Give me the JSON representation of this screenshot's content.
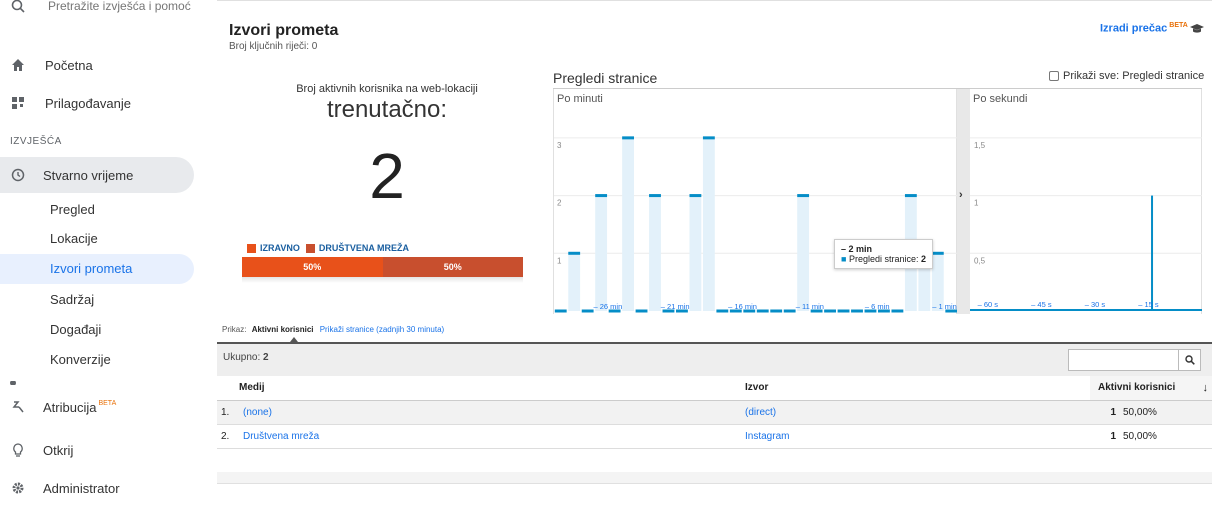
{
  "sidebar": {
    "search_placeholder": "Pretražite izvješća i pomoć",
    "home": "Početna",
    "customize": "Prilagođavanje",
    "reports_header": "IZVJEŠĆA",
    "realtime": "Stvarno vrijeme",
    "sub": [
      "Pregled",
      "Lokacije",
      "Izvori prometa",
      "Sadržaj",
      "Događaji",
      "Konverzije"
    ],
    "attribution": "Atribucija",
    "attribution_badge": "BETA",
    "discover": "Otkrij",
    "admin": "Administrator"
  },
  "header": {
    "title": "Izvori prometa",
    "keywords": "Broj ključnih riječi: 0",
    "shortcut": "Izradi prečac",
    "shortcut_badge": "BETA"
  },
  "active_users": {
    "label": "Broj aktivnih korisnika na web-lokaciji",
    "now": "trenutačno:",
    "count": "2",
    "legend": [
      "IZRAVNO",
      "DRUŠTVENA MREŽA"
    ],
    "bar": [
      "50%",
      "50%"
    ],
    "colors": [
      "#e8511a",
      "#c84f2e"
    ]
  },
  "pageviews": {
    "title": "Pregledi stranice",
    "show_all": "Prikaži sve: Pregledi stranice",
    "per_minute": "Po minuti",
    "per_second": "Po sekundi",
    "tooltip_title": "– 2 min",
    "tooltip_label": "Pregledi stranice:",
    "tooltip_value": "2",
    "min_yticks": [
      "3",
      "2",
      "1"
    ],
    "min_xticks": [
      "– 26 min",
      "– 21 min",
      "– 16 min",
      "– 11 min",
      "– 6 min",
      "– 1 min"
    ],
    "sec_yticks": [
      "1,5",
      "1",
      "0,5"
    ],
    "sec_xticks": [
      "– 60 s",
      "– 45 s",
      "– 30 s",
      "– 15 s"
    ]
  },
  "chart_data": [
    {
      "type": "bar",
      "title": "Po minuti",
      "series": [
        {
          "name": "Pregledi stranice",
          "values": [
            0,
            1,
            0,
            2,
            0,
            3,
            0,
            2,
            0,
            0,
            2,
            3,
            0,
            0,
            0,
            0,
            0,
            0,
            2,
            0,
            0,
            0,
            0,
            0,
            0,
            0,
            2,
            1,
            1,
            0
          ]
        }
      ],
      "ylim": [
        0,
        3.5
      ],
      "color": "#058dc7"
    },
    {
      "type": "bar",
      "title": "Po sekundi",
      "values_at": [
        {
          "x": -14,
          "y": 1
        }
      ],
      "ylim": [
        0,
        1.75
      ],
      "color": "#058dc7"
    }
  ],
  "view": {
    "prefix": "Prikaz:",
    "active": "Aktivni korisnici",
    "other": "Prikaži stranice (zadnjih 30 minuta)"
  },
  "table": {
    "total_label": "Ukupno:",
    "total": "2",
    "headers": [
      "Medij",
      "Izvor",
      "Aktivni korisnici"
    ],
    "rows": [
      {
        "n": "1.",
        "medium": "(none)",
        "source": "(direct)",
        "count": "1",
        "pct": "50,00%"
      },
      {
        "n": "2.",
        "medium": "Društvena mreža",
        "source": "Instagram",
        "count": "1",
        "pct": "50,00%"
      }
    ]
  }
}
